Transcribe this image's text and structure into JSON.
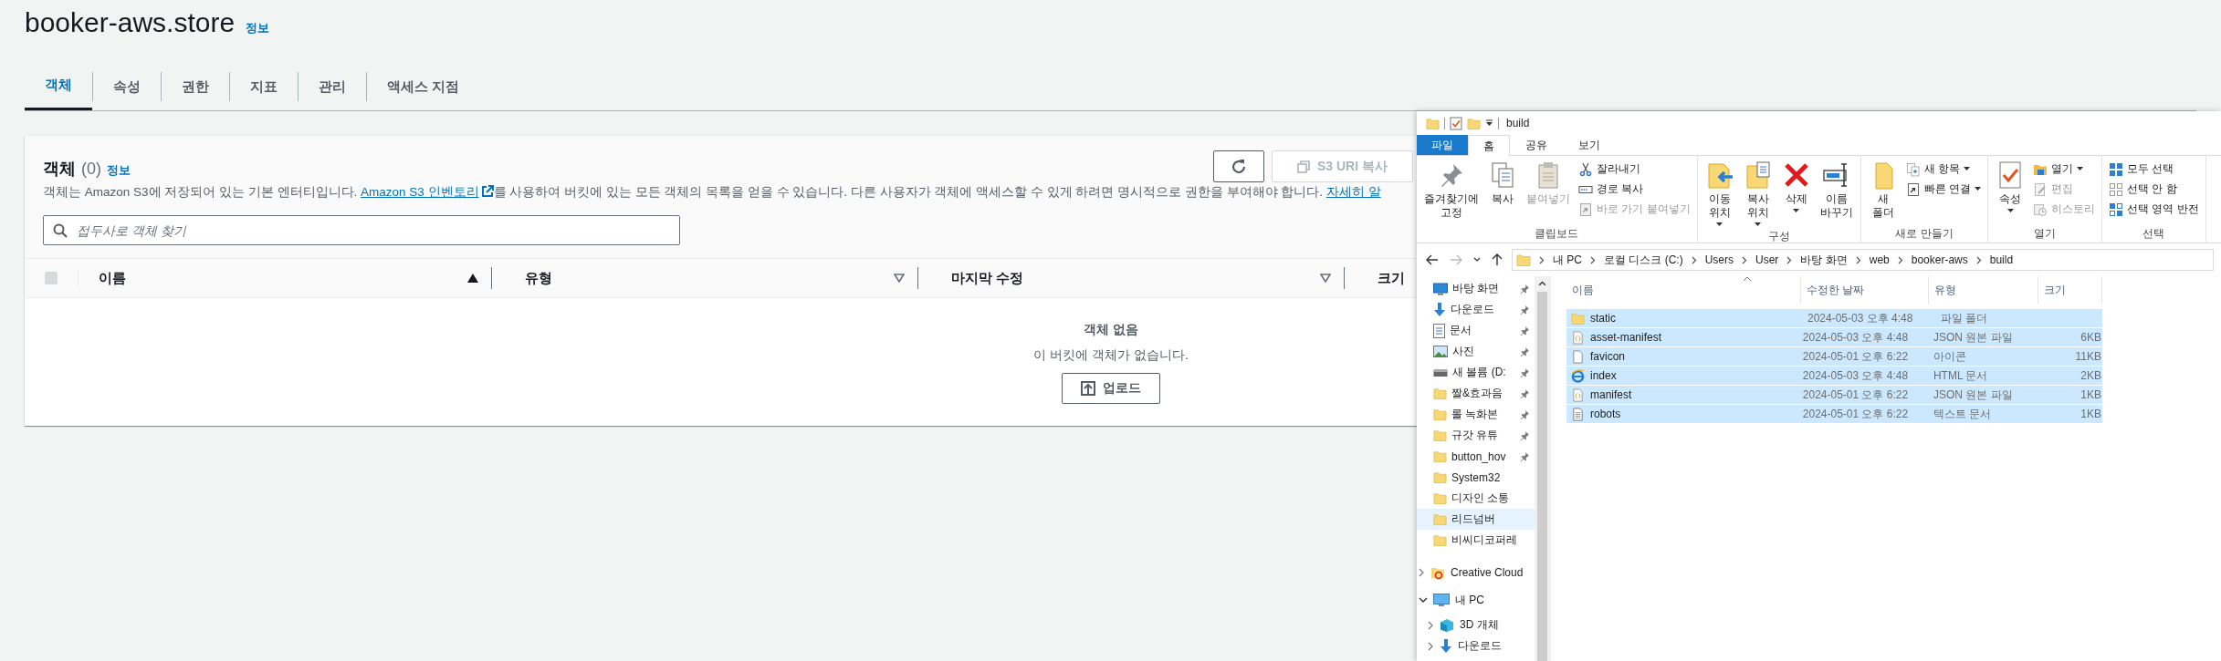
{
  "aws": {
    "title": "booker-aws.store",
    "info": "정보",
    "tabs": [
      {
        "label": "객체",
        "selected": true
      },
      {
        "label": "속성",
        "selected": false
      },
      {
        "label": "권한",
        "selected": false
      },
      {
        "label": "지표",
        "selected": false
      },
      {
        "label": "관리",
        "selected": false
      },
      {
        "label": "액세스 지점",
        "selected": false
      }
    ],
    "panel": {
      "heading": "객체",
      "count": "(0)",
      "info": "정보",
      "description": {
        "before": "객체는 Amazon S3에 저장되어 있는 기본 엔터티입니다. ",
        "link": "Amazon S3 인벤토리",
        "after": "를 사용하여 버킷에 있는 모든 객체의 목록을 얻을 수 있습니다. 다른 사용자가 객체에 액세스할 수 있게 하려면 명시적으로 권한을 부여해야 합니다. ",
        "more_link": "자세히 알"
      },
      "copy_uri_button": {
        "label": "S3 URI 복사",
        "disabled": true
      },
      "search": {
        "placeholder": "접두사로 객체 찾기"
      },
      "select_all": {
        "checked": false
      },
      "columns": [
        {
          "label": "이름",
          "sorted": true
        },
        {
          "label": "유형",
          "sorted": false
        },
        {
          "label": "마지막 수정",
          "sorted": false
        },
        {
          "label": "크기"
        }
      ],
      "empty": {
        "title": "객체 없음",
        "message": "이 버킷에 객체가 없습니다.",
        "button": "업로드"
      }
    }
  },
  "explorer": {
    "title": "build",
    "ribbon_tabs": [
      {
        "label": "파일",
        "kind": "file",
        "selected": false
      },
      {
        "label": "홈",
        "kind": "tab",
        "selected": true
      },
      {
        "label": "공유",
        "kind": "tab",
        "selected": false
      },
      {
        "label": "보기",
        "kind": "tab",
        "selected": false
      }
    ],
    "ribbon_groups": [
      {
        "label": "클립보드",
        "items": [
          {
            "label": "즐겨찾기에 고정",
            "kind": "large",
            "dropdown": false,
            "disabled": false
          },
          {
            "label": "복사",
            "kind": "large",
            "dropdown": false,
            "disabled": false
          },
          {
            "label": "붙여넣기",
            "kind": "large",
            "dropdown": false,
            "disabled": true
          },
          {
            "label": "잘라내기",
            "kind": "small",
            "dropdown": false,
            "disabled": false
          },
          {
            "label": "경로 복사",
            "kind": "small",
            "dropdown": false,
            "disabled": false
          },
          {
            "label": "바로 가기 붙여넣기",
            "kind": "small",
            "dropdown": false,
            "disabled": true
          }
        ]
      },
      {
        "label": "구성",
        "items": [
          {
            "label": "이동 위치",
            "kind": "large",
            "dropdown": true,
            "disabled": false
          },
          {
            "label": "복사 위치",
            "kind": "large",
            "dropdown": true,
            "disabled": false
          },
          {
            "label": "삭제",
            "kind": "large",
            "dropdown": true,
            "disabled": false
          },
          {
            "label": "이름 바꾸기",
            "kind": "large",
            "dropdown": false,
            "disabled": false
          }
        ]
      },
      {
        "label": "새로 만들기",
        "items": [
          {
            "label": "새 폴더",
            "kind": "large",
            "dropdown": false,
            "disabled": false
          },
          {
            "label": "새 항목",
            "kind": "small",
            "dropdown": true,
            "disabled": false
          },
          {
            "label": "빠른 연결",
            "kind": "small",
            "dropdown": true,
            "disabled": false
          }
        ]
      },
      {
        "label": "열기",
        "items": [
          {
            "label": "속성",
            "kind": "large",
            "dropdown": true,
            "disabled": false
          },
          {
            "label": "열기",
            "kind": "small",
            "dropdown": true,
            "disabled": false
          },
          {
            "label": "편집",
            "kind": "small",
            "dropdown": false,
            "disabled": true
          },
          {
            "label": "히스토리",
            "kind": "small",
            "dropdown": false,
            "disabled": true
          }
        ]
      },
      {
        "label": "선택",
        "items": [
          {
            "label": "모두 선택",
            "kind": "small",
            "dropdown": false,
            "disabled": false
          },
          {
            "label": "선택 안 함",
            "kind": "small",
            "dropdown": false,
            "disabled": false
          },
          {
            "label": "선택 영역 반전",
            "kind": "small",
            "dropdown": false,
            "disabled": false
          }
        ]
      }
    ],
    "path": [
      "내 PC",
      "로컬 디스크 (C:)",
      "Users",
      "User",
      "바탕 화면",
      "web",
      "booker-aws",
      "build"
    ],
    "quick_access": [
      {
        "label": "바탕 화면",
        "kind": "desktop",
        "pinned": true,
        "highlighted": false
      },
      {
        "label": "다운로드",
        "kind": "download",
        "pinned": true,
        "highlighted": false
      },
      {
        "label": "문서",
        "kind": "document",
        "pinned": true,
        "highlighted": false
      },
      {
        "label": "사진",
        "kind": "picture",
        "pinned": true,
        "highlighted": false
      },
      {
        "label": "새 볼륨 (D:",
        "kind": "drive",
        "pinned": true,
        "highlighted": false
      },
      {
        "label": "짤&효과음",
        "kind": "folder",
        "pinned": true,
        "highlighted": false
      },
      {
        "label": "롤 녹화본",
        "kind": "folder",
        "pinned": true,
        "highlighted": false
      },
      {
        "label": "규갓 유튜",
        "kind": "folder",
        "pinned": true,
        "highlighted": false
      },
      {
        "label": "button_hov",
        "kind": "folder",
        "pinned": true,
        "highlighted": false
      },
      {
        "label": "System32",
        "kind": "folder",
        "pinned": false,
        "highlighted": false
      },
      {
        "label": "디자인 소통",
        "kind": "folder",
        "pinned": false,
        "highlighted": false
      },
      {
        "label": "리드넘버",
        "kind": "folder",
        "pinned": false,
        "highlighted": true
      },
      {
        "label": "비씨디코퍼레",
        "kind": "folder",
        "pinned": false,
        "highlighted": false
      }
    ],
    "tree": [
      {
        "label": "Creative Cloud",
        "kind": "cloud",
        "expanded": false
      },
      {
        "label": "내 PC",
        "kind": "pc",
        "expanded": true,
        "children": [
          {
            "label": "3D 개체",
            "kind": "cube",
            "expanded": false
          },
          {
            "label": "다운로드",
            "kind": "download",
            "expanded": false
          }
        ]
      }
    ],
    "columns": [
      "이름",
      "수정한 날짜",
      "유형",
      "크기"
    ],
    "files": [
      {
        "name": "static",
        "modified": "2024-05-03 오후 4:48",
        "type": "파일 폴더",
        "kind": "folder",
        "selected": true
      },
      {
        "name": "asset-manifest",
        "modified": "2024-05-03 오후 4:48",
        "type": "JSON 원본 파일",
        "size": "6KB",
        "kind": "json",
        "selected": true
      },
      {
        "name": "favicon",
        "modified": "2024-05-01 오후 6:22",
        "type": "아이콘",
        "size": "11KB",
        "kind": "file",
        "selected": true
      },
      {
        "name": "index",
        "modified": "2024-05-03 오후 4:48",
        "type": "HTML 문서",
        "size": "2KB",
        "kind": "html",
        "selected": true
      },
      {
        "name": "manifest",
        "modified": "2024-05-01 오후 6:22",
        "type": "JSON 원본 파일",
        "size": "1KB",
        "kind": "json",
        "selected": true
      },
      {
        "name": "robots",
        "modified": "2024-05-01 오후 6:22",
        "type": "텍스트 문서",
        "size": "1KB",
        "kind": "text",
        "selected": true
      }
    ]
  }
}
